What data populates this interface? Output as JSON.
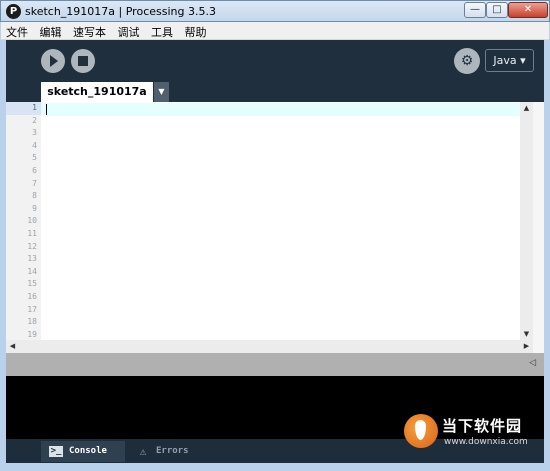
{
  "window": {
    "title": "sketch_191017a | Processing 3.5.3",
    "app_icon_glyph": "P",
    "controls": {
      "minimize": "—",
      "maximize": "□",
      "close": "✕"
    }
  },
  "menu": [
    "文件",
    "编辑",
    "速写本",
    "调试",
    "工具",
    "帮助"
  ],
  "toolbar": {
    "run_icon": "play-icon",
    "stop_icon": "stop-icon",
    "debug_icon_glyph": "⚙",
    "mode_label": "Java ▾"
  },
  "tabs": {
    "active_label": "sketch_191017a",
    "menu_arrow": "▼"
  },
  "editor": {
    "line_numbers": [
      "1",
      "2",
      "3",
      "4",
      "5",
      "6",
      "7",
      "8",
      "9",
      "10",
      "11",
      "12",
      "13",
      "14",
      "15",
      "16",
      "17",
      "18",
      "19"
    ],
    "current_line": 1,
    "content": ""
  },
  "scroll": {
    "up": "▲",
    "down": "▼",
    "left": "◀",
    "right": "▶"
  },
  "status": {
    "collapse_glyph": "◁"
  },
  "footer": {
    "console_label": "Console",
    "console_icon_glyph": ">_",
    "errors_label": "Errors",
    "errors_icon_glyph": "⚠"
  },
  "watermark": {
    "text": "当下软件园",
    "url": "www.downxia.com"
  },
  "colors": {
    "toolbar_bg": "#1f2f3d",
    "console_bg": "#000000",
    "current_line_bg": "#e5fefe"
  }
}
